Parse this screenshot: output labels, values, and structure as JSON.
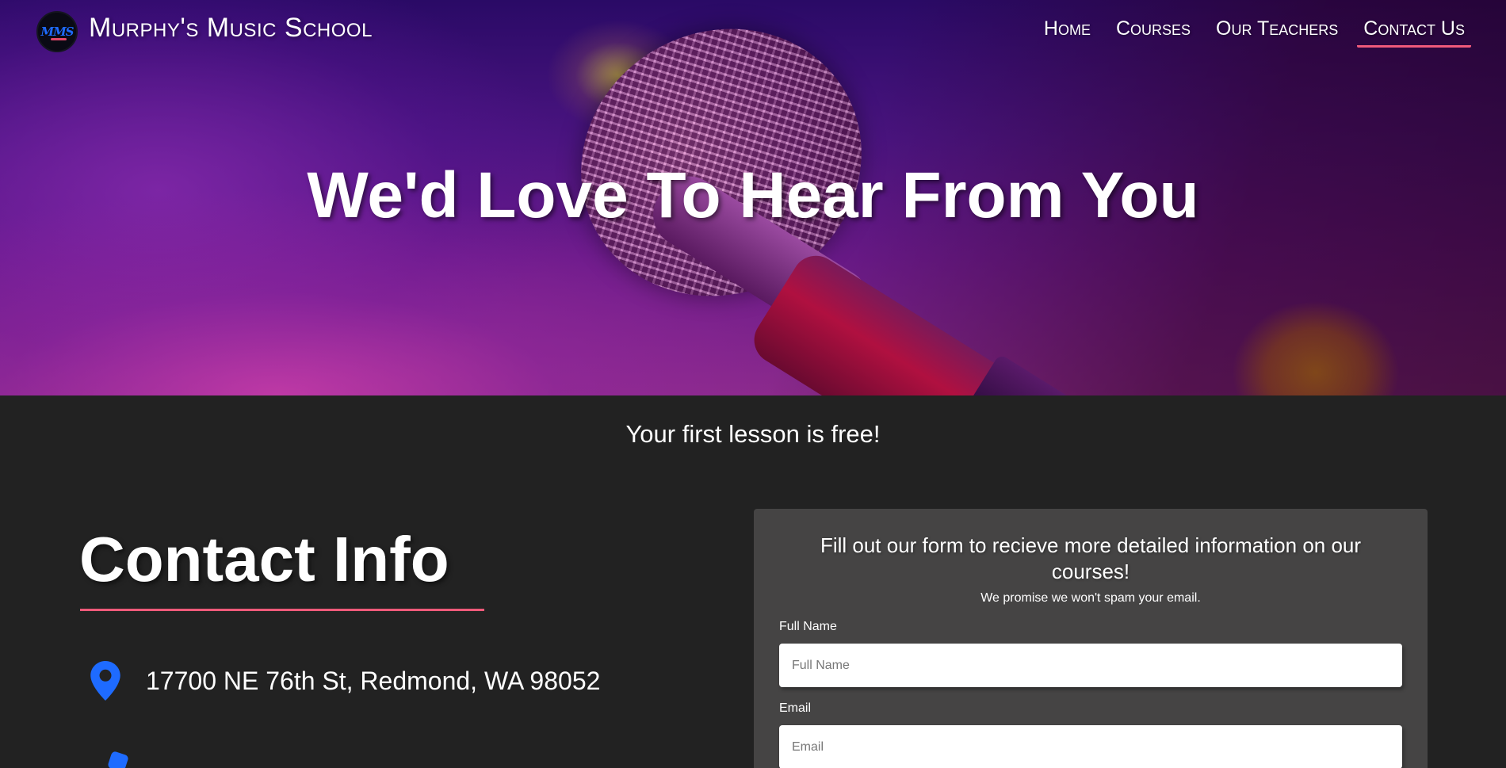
{
  "brand": {
    "logo_text": "MMS",
    "name": "Murphy's Music School"
  },
  "nav": {
    "items": [
      {
        "label": "Home",
        "active": false
      },
      {
        "label": "Courses",
        "active": false
      },
      {
        "label": "Our Teachers",
        "active": false
      },
      {
        "label": "Contact Us",
        "active": true
      }
    ]
  },
  "hero": {
    "title": "We'd Love To Hear From You"
  },
  "tagline": "Your first lesson is free!",
  "contact": {
    "title": "Contact Info",
    "address": "17700 NE 76th St, Redmond, WA 98052"
  },
  "form": {
    "heading": "Fill out our form to recieve more detailed information on our courses!",
    "subheading": "We promise we won't spam your email.",
    "fields": [
      {
        "label": "Full Name",
        "placeholder": "Full Name"
      },
      {
        "label": "Email",
        "placeholder": "Email"
      }
    ]
  },
  "colors": {
    "accent": "#ef5a7a",
    "icon_blue": "#1e6bff",
    "background": "#222222",
    "card": "#454444"
  }
}
